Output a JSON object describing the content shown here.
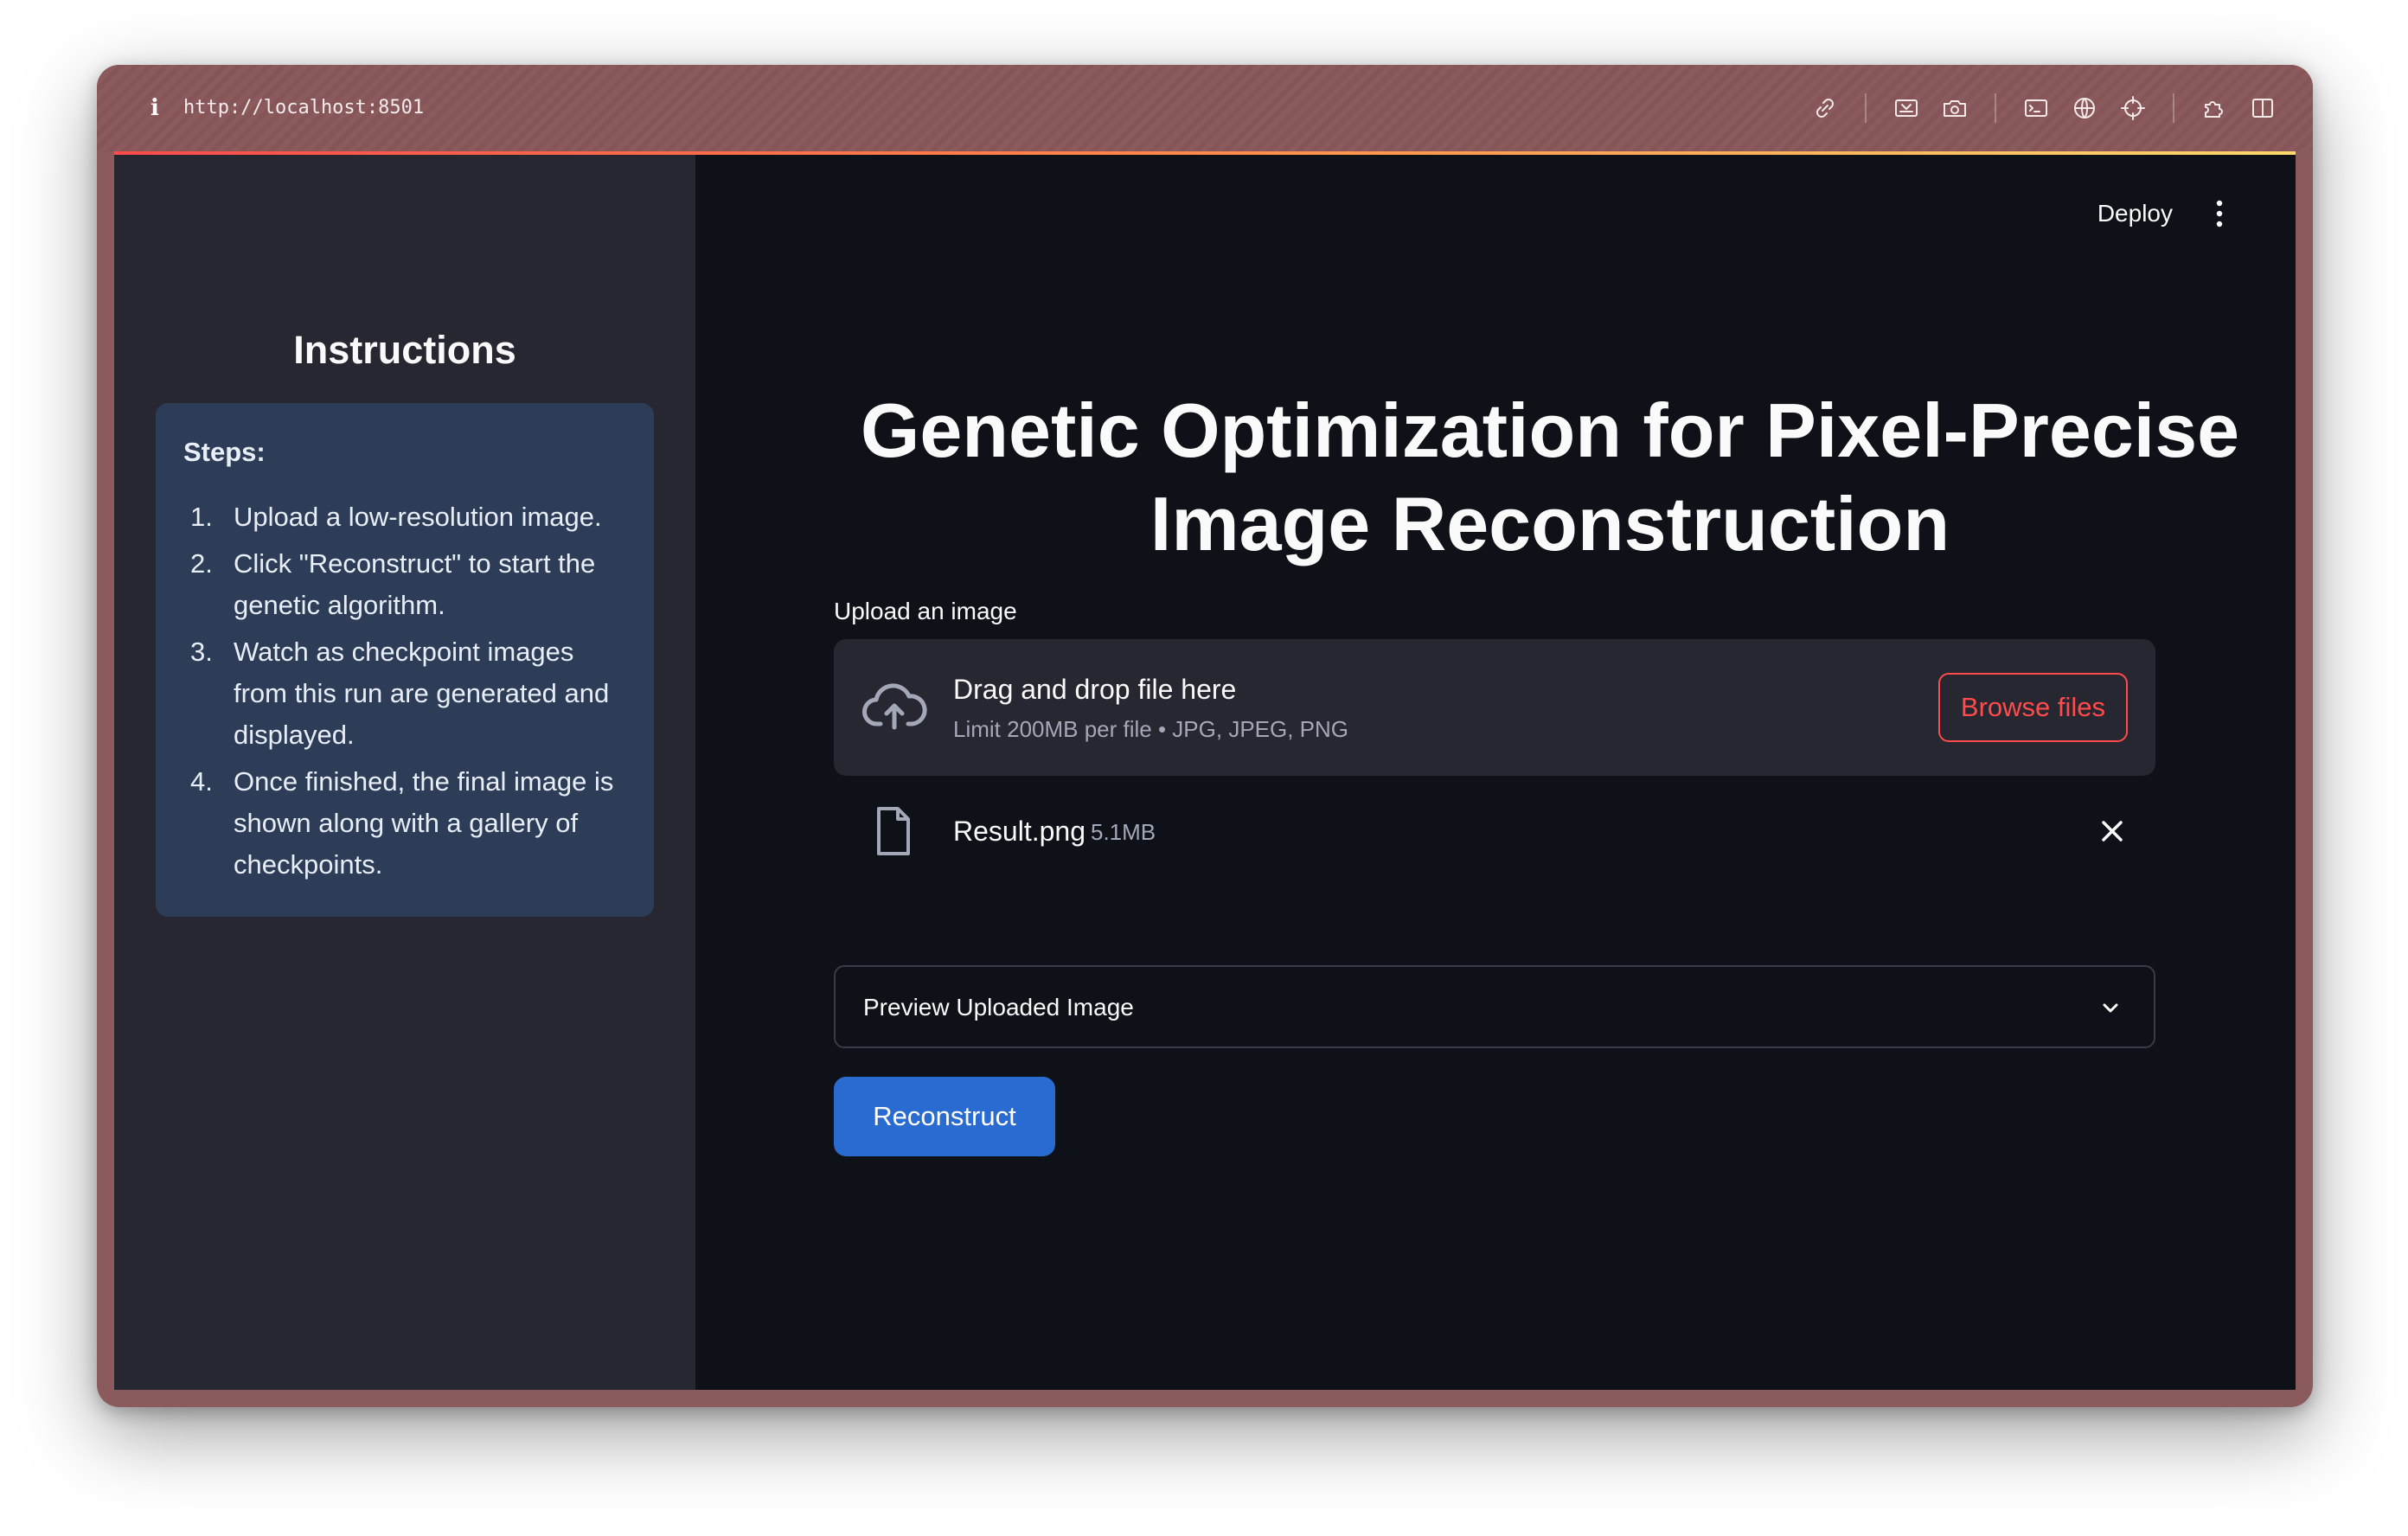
{
  "browser": {
    "url": "http://localhost:8501",
    "toolbar_icons": [
      "link-icon",
      "screenshot-region-icon",
      "camera-icon",
      "terminal-icon",
      "globe-icon",
      "crosshair-icon",
      "puzzle-icon",
      "split-view-icon"
    ]
  },
  "header": {
    "deploy_label": "Deploy"
  },
  "sidebar": {
    "title": "Instructions",
    "steps_heading": "Steps:",
    "steps": [
      {
        "num": "1.",
        "text": "Upload a low-resolution image."
      },
      {
        "num": "2.",
        "text": "Click \"Reconstruct\" to start the genetic algorithm."
      },
      {
        "num": "3.",
        "text": "Watch as checkpoint images from this run are generated and displayed."
      },
      {
        "num": "4.",
        "text": "Once finished, the final image is shown along with a gallery of checkpoints."
      }
    ]
  },
  "main": {
    "title": "Genetic Optimization for Pixel-Precise Image Reconstruction",
    "upload_label": "Upload an image",
    "dropzone": {
      "main_text": "Drag and drop file here",
      "sub_text": "Limit 200MB per file • JPG, JPEG, PNG",
      "browse_label": "Browse files"
    },
    "uploaded_file": {
      "name": "Result.png",
      "size": "5.1MB"
    },
    "expander_label": "Preview Uploaded Image",
    "reconstruct_label": "Reconstruct"
  },
  "colors": {
    "app_background": "#0e1117",
    "sidebar_background": "#262730",
    "instruction_card": "#2e3d57",
    "primary_button": "#2a6bd1",
    "accent_red": "#ff4b4b",
    "window_frame": "#8b5a5c"
  }
}
